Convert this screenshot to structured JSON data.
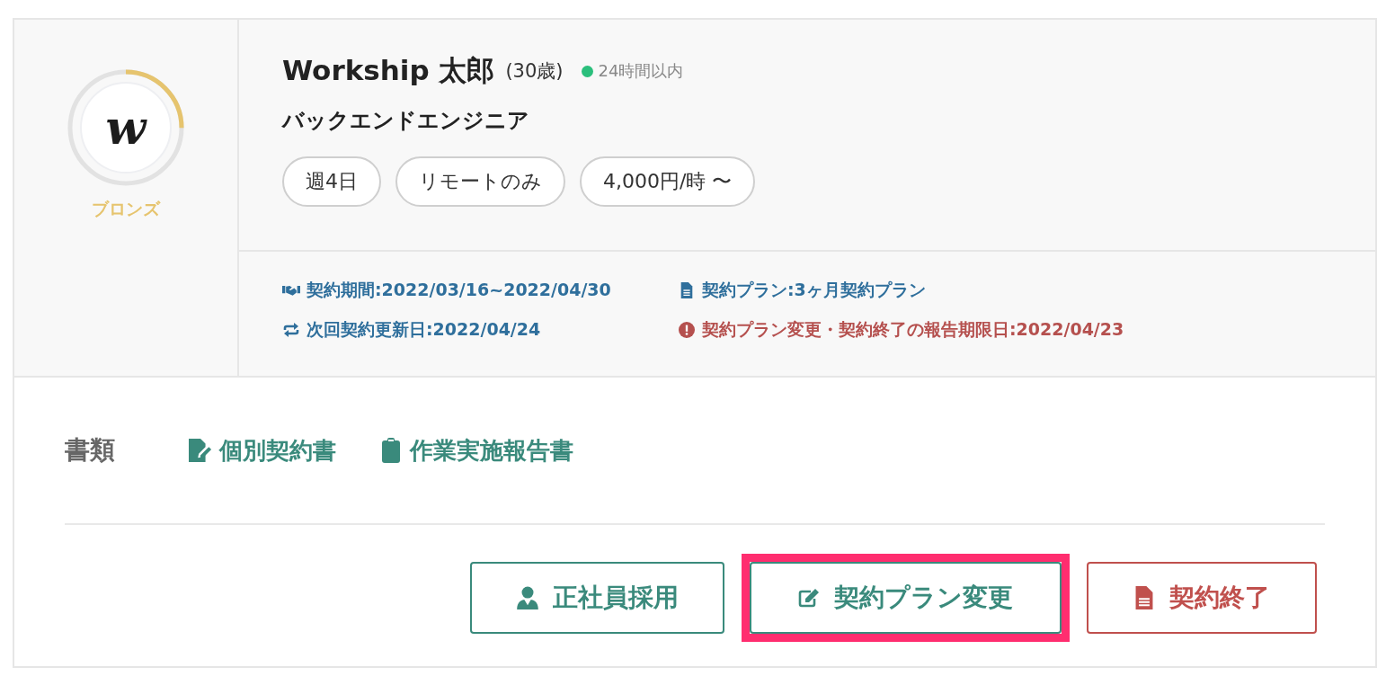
{
  "profile": {
    "avatar_letter": "w",
    "rank": "ブロンズ",
    "name": "Workship 太郎",
    "age": "(30歳)",
    "online": true,
    "last_seen": "24時間以内",
    "role": "バックエンドエンジニア",
    "tags": [
      "週4日",
      "リモートのみ",
      "4,000円/時 〜"
    ]
  },
  "contract": [
    {
      "kind": "handshake",
      "label": "契約期間:2022/03/16~2022/04/30",
      "alert": false
    },
    {
      "kind": "document",
      "label": "契約プラン:3ヶ月契約プラン",
      "alert": false
    },
    {
      "kind": "renew",
      "label": "次回契約更新日:2022/04/24",
      "alert": false
    },
    {
      "kind": "warning",
      "label": "契約プラン変更・契約終了の報告期限日:2022/04/23",
      "alert": true
    }
  ],
  "documents": {
    "label": "書類",
    "links": [
      {
        "kind": "signed",
        "label": "個別契約書"
      },
      {
        "kind": "clipboard",
        "label": "作業実施報告書"
      }
    ]
  },
  "buttons": [
    {
      "kind": "hire",
      "label": "正社員採用",
      "danger": false,
      "highlighted": false
    },
    {
      "kind": "edit",
      "label": "契約プラン変更",
      "danger": false,
      "highlighted": true
    },
    {
      "kind": "end",
      "label": "契約終了",
      "danger": true,
      "highlighted": false
    }
  ]
}
